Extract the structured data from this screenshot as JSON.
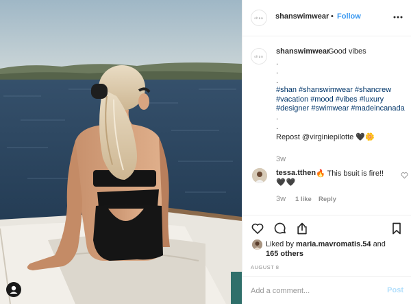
{
  "post": {
    "username": "shanswimwear",
    "dot": "•",
    "follow_label": "Follow",
    "brand_avatar_text": "shan"
  },
  "caption": {
    "username": "shanswimwear",
    "first_line": "Good vibes",
    "lines": [
      ".",
      ".",
      "."
    ],
    "hashtags": [
      "#shan #shanswimwear #shancrew",
      "#vacation #mood #vibes #luxury",
      "#designer #swimwear #madeincanada"
    ],
    "dots2": [
      ".",
      "."
    ],
    "repost": "Repost @virginiepilotte 🖤🌼",
    "time": "3w"
  },
  "comment": {
    "username": "tessa.tthen",
    "text": "🔥 This bsuit is fire!!",
    "line2": "🖤🖤",
    "time": "3w",
    "likes": "1 like",
    "reply_label": "Reply"
  },
  "likes": {
    "prefix": "Liked by",
    "user": "maria.mavromatis.54",
    "and": "and",
    "others": "165 others"
  },
  "date": "AUGUST 8",
  "add_comment": {
    "placeholder": "Add a comment...",
    "post_label": "Post"
  },
  "colors": {
    "accent": "#3897f0",
    "hashtag": "#003569",
    "muted": "#8e8e8e",
    "post_disabled": "#b2dffc"
  },
  "icons": {
    "header_more": "more-horizontal-icon",
    "like": "heart-icon",
    "comment": "comment-bubble-icon",
    "share": "share-upload-icon",
    "save": "bookmark-icon",
    "photo_tag": "user-tag-icon"
  }
}
